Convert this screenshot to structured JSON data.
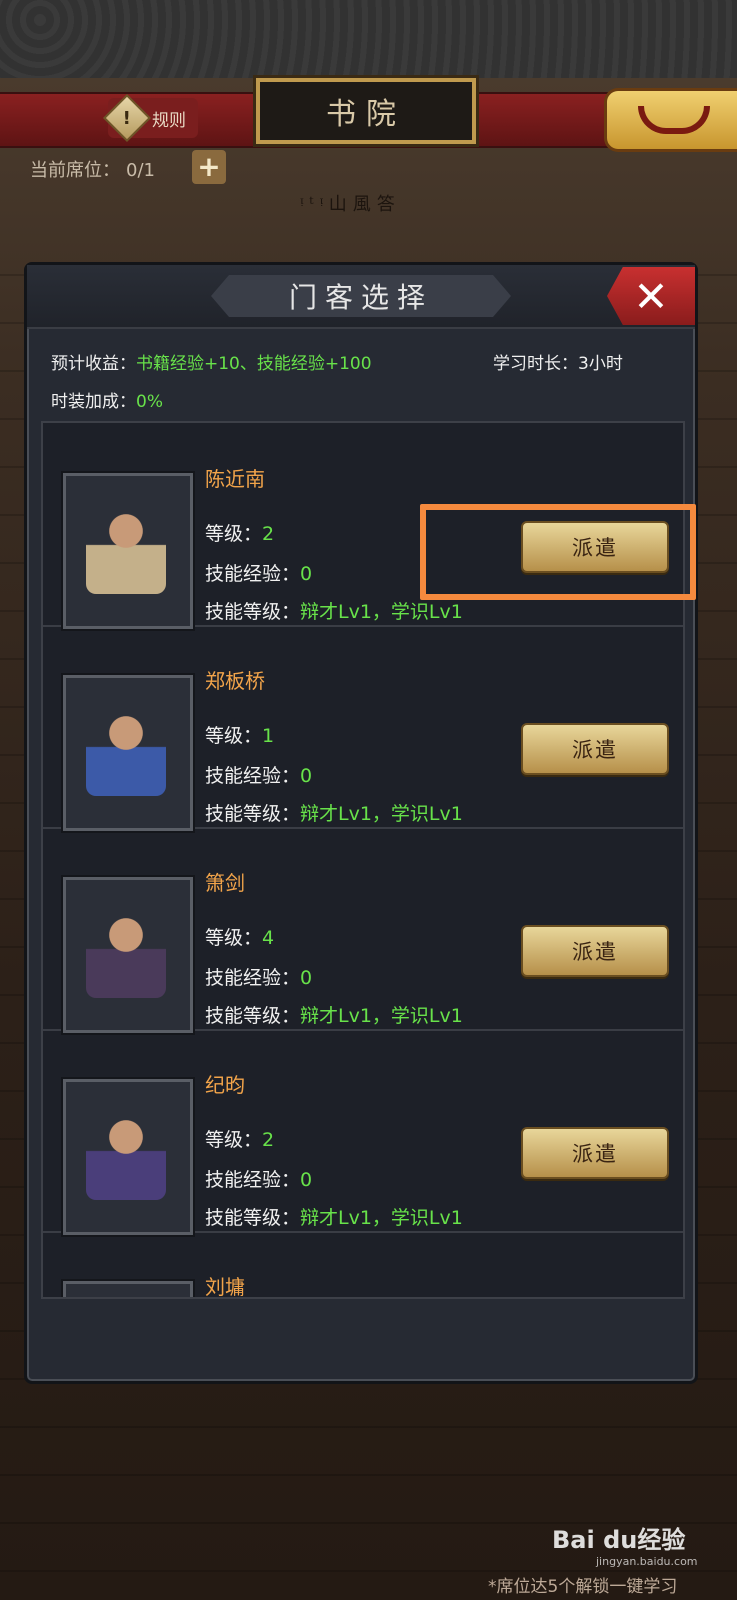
{
  "header": {
    "rules_label": "规则",
    "title": "书院",
    "seat_label": "当前席位：",
    "seat_value": "0/1",
    "shelf_text": "ᵎᵗᵎ山風答"
  },
  "dialog": {
    "title": "门客选择",
    "expected_label": "预计收益：",
    "expected_value": "书籍经验+10、技能经验+100",
    "duration_label": "学习时长：",
    "duration_value": "3小时",
    "costume_label": "时装加成：",
    "costume_value": "0%"
  },
  "labels": {
    "level": "等级：",
    "skill_exp": "技能经验：",
    "skill_level": "技能等级：",
    "dispatch": "派遣"
  },
  "retainers": [
    {
      "name": "陈近南",
      "level": "2",
      "skill_exp": "0",
      "skills": "辩才Lv1，学识Lv1",
      "robe": "#c4b08a"
    },
    {
      "name": "郑板桥",
      "level": "1",
      "skill_exp": "0",
      "skills": "辩才Lv1，学识Lv1",
      "robe": "#3c5aa8"
    },
    {
      "name": "箫剑",
      "level": "4",
      "skill_exp": "0",
      "skills": "辩才Lv1，学识Lv1",
      "robe": "#4a3a5a"
    },
    {
      "name": "纪昀",
      "level": "2",
      "skill_exp": "0",
      "skills": "辩才Lv1，学识Lv1",
      "robe": "#4a3e7a"
    },
    {
      "name": "刘墉"
    }
  ],
  "footer": {
    "note": "*席位达5个解锁一键学习",
    "watermark_brand": "Bai du经验",
    "watermark_url": "jingyan.baidu.com"
  }
}
